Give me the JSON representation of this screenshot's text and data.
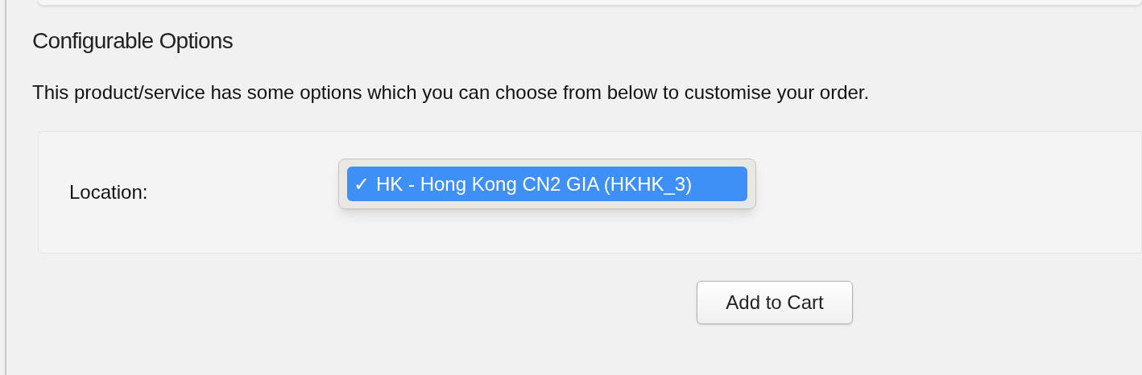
{
  "section": {
    "title": "Configurable Options",
    "description": "This product/service has some options which you can choose from below to customise your order."
  },
  "options": [
    {
      "label": "Location:",
      "menu": {
        "items": [
          {
            "check": "✓",
            "label": "HK - Hong Kong CN2 GIA (HKHK_3)",
            "selected": true
          }
        ]
      }
    }
  ],
  "button": "Add to Cart"
}
